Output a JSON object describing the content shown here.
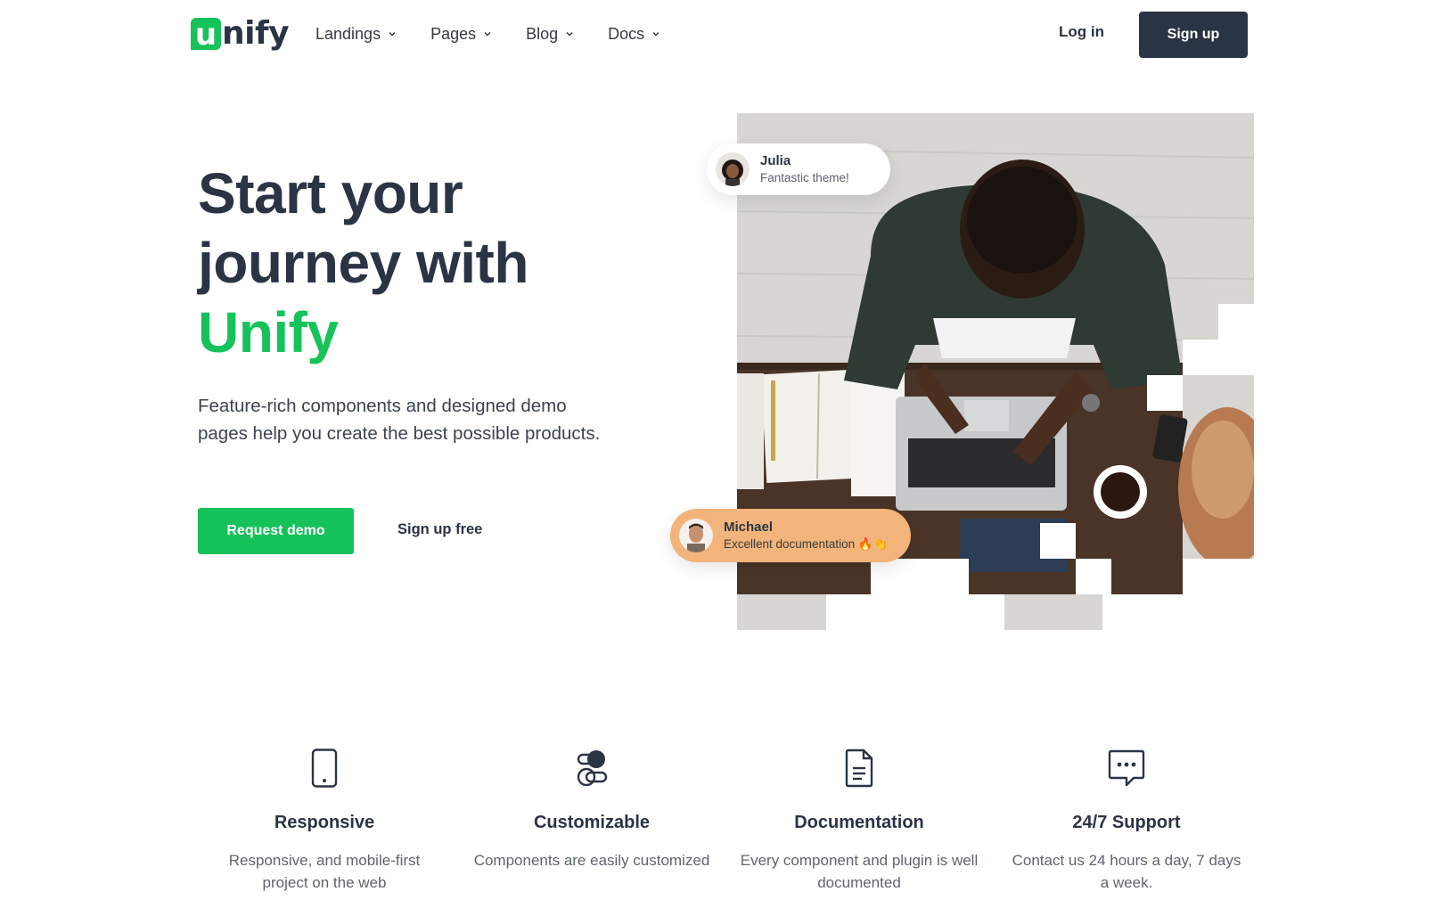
{
  "header": {
    "logo": {
      "letter": "u",
      "rest": "nify"
    },
    "nav": [
      {
        "label": "Landings",
        "icon": "chevron-down-icon"
      },
      {
        "label": "Pages",
        "icon": "chevron-down-icon"
      },
      {
        "label": "Blog",
        "icon": "chevron-down-icon"
      },
      {
        "label": "Docs",
        "icon": "chevron-down-icon"
      }
    ],
    "login_label": "Log in",
    "signup_label": "Sign up"
  },
  "hero": {
    "title_line1": "Start your",
    "title_line2": "journey with",
    "title_brand": "Unify",
    "description": "Feature-rich components and designed demo pages help you create the best possible products.",
    "primary_cta": "Request demo",
    "secondary_cta": "Sign up free"
  },
  "testimonials": [
    {
      "name": "Julia",
      "message": "Fantastic theme!"
    },
    {
      "name": "Michael",
      "message": "Excellent documentation 🔥👏"
    }
  ],
  "features": [
    {
      "icon": "smartphone-icon",
      "title": "Responsive",
      "description": "Responsive, and mobile-first project on the web"
    },
    {
      "icon": "toggle-icon",
      "title": "Customizable",
      "description": "Components are easily customized"
    },
    {
      "icon": "document-icon",
      "title": "Documentation",
      "description": "Every component and plugin is well documented"
    },
    {
      "icon": "chat-bubble-icon",
      "title": "24/7 Support",
      "description": "Contact us 24 hours a day, 7 days a week."
    }
  ],
  "colors": {
    "brand_green": "#16c25a",
    "dark": "#2b3445",
    "highlight_peach": "#f7d8bd",
    "michael_bubble": "#f2b47a"
  }
}
